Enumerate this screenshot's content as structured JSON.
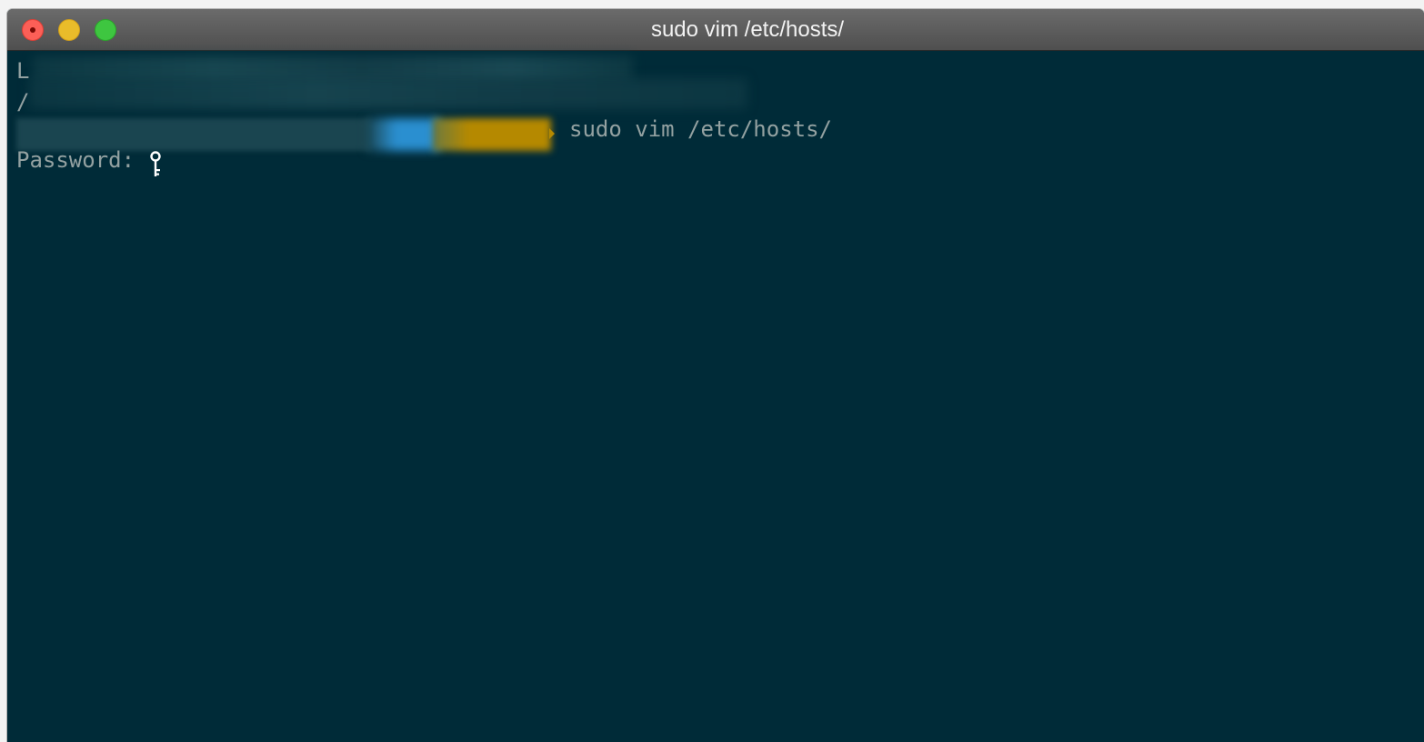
{
  "window": {
    "title": "sudo vim /etc/hosts/"
  },
  "terminal": {
    "line1_visible_char": "L",
    "line2_visible_char": "/",
    "command": "sudo vim /etc/hosts/",
    "password_prompt": "Password:"
  },
  "colors": {
    "background": "#002b38",
    "text": "#93a1a1",
    "prompt_blue": "#2a8fd0",
    "prompt_yellow": "#b58900"
  },
  "icons": {
    "cursor": "key-icon"
  }
}
